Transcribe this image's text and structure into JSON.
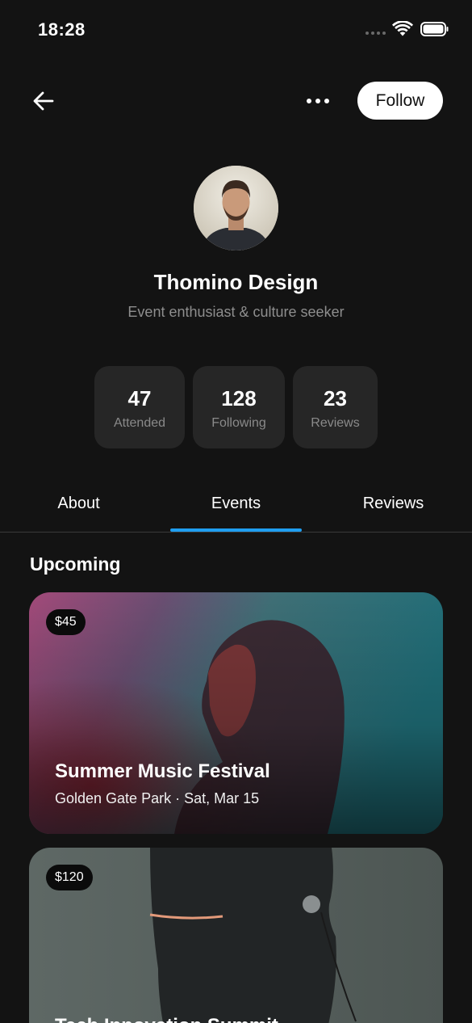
{
  "status_bar": {
    "time": "18:28"
  },
  "header": {
    "back_icon": "arrow-left-icon",
    "more_icon": "more-horizontal-icon",
    "follow_label": "Follow"
  },
  "profile": {
    "name": "Thomino Design",
    "bio": "Event enthusiast & culture seeker"
  },
  "stats": [
    {
      "value": "47",
      "label": "Attended"
    },
    {
      "value": "128",
      "label": "Following"
    },
    {
      "value": "23",
      "label": "Reviews"
    }
  ],
  "tabs": [
    {
      "label": "About",
      "active": false
    },
    {
      "label": "Events",
      "active": true
    },
    {
      "label": "Reviews",
      "active": false
    }
  ],
  "colors": {
    "background": "#131313",
    "card": "#262626",
    "accent": "#1f9ef0",
    "muted_text": "#8e8e8e"
  },
  "upcoming": {
    "title": "Upcoming",
    "events": [
      {
        "price": "$45",
        "title": "Summer Music Festival",
        "subtitle": "Golden Gate Park · Sat, Mar 15"
      },
      {
        "price": "$120",
        "title": "Tech Innovation Summit",
        "subtitle": ""
      }
    ]
  }
}
